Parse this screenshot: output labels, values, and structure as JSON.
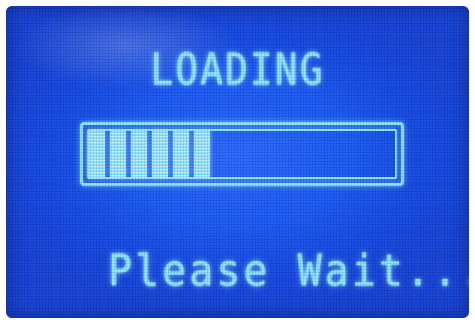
{
  "screen": {
    "title": "LOADING",
    "status_text": "Please Wait...",
    "progress": {
      "filled_segments": 6,
      "total_segments": 15,
      "fraction": 0.4
    }
  },
  "colors": {
    "lcd_background": "#1f5ff7",
    "lcd_text": "#8fe9ff",
    "segment_fill": "#b8f4ff"
  }
}
